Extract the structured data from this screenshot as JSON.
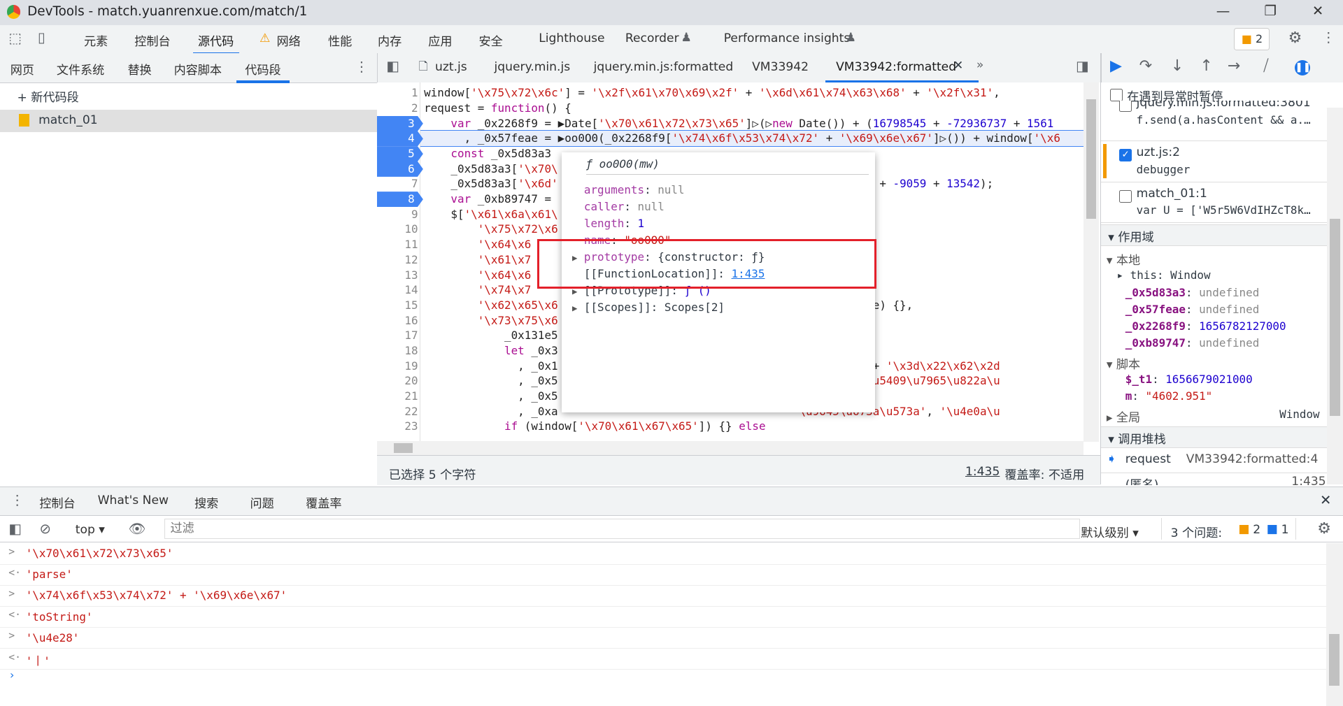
{
  "window": {
    "title": "DevTools - match.yuanrenxue.com/match/1"
  },
  "main_tabs": [
    "元素",
    "控制台",
    "源代码",
    "网络",
    "性能",
    "内存",
    "应用",
    "安全",
    "Lighthouse",
    "Recorder",
    "Performance insights"
  ],
  "issues_badge": "2",
  "navigator_tabs": [
    "网页",
    "文件系统",
    "替换",
    "内容脚本",
    "代码段"
  ],
  "new_snippet": "新代码段",
  "snippet_file": "match_01",
  "editor_tabs": [
    "uzt.js",
    "jquery.min.js",
    "jquery.min.js:formatted",
    "VM33942",
    "VM33942:formatted"
  ],
  "code_lines": [
    {
      "n": "1",
      "bp": false,
      "t": [
        [
          "",
          "window["
        ],
        [
          "s",
          "'\\x75\\x72\\x6c'"
        ],
        [
          "",
          "] = "
        ],
        [
          "s",
          "'\\x2f\\x61\\x70\\x69\\x2f'"
        ],
        [
          "",
          " + "
        ],
        [
          "s",
          "'\\x6d\\x61\\x74\\x63\\x68'"
        ],
        [
          "",
          " + "
        ],
        [
          "s",
          "'\\x2f\\x31'"
        ],
        [
          "",
          ","
        ]
      ]
    },
    {
      "n": "2",
      "bp": false,
      "t": [
        [
          "",
          "request = "
        ],
        [
          "k",
          "function"
        ],
        [
          "",
          "() {"
        ]
      ]
    },
    {
      "n": "3",
      "bp": true,
      "t": [
        [
          "",
          "    "
        ],
        [
          "k",
          "var"
        ],
        [
          "",
          " _0x2268f9 = ▶Date["
        ],
        [
          "s",
          "'\\x70\\x61\\x72\\x73\\x65'"
        ],
        [
          "",
          "]▷(▷"
        ],
        [
          "k",
          "new"
        ],
        [
          "",
          " Date()) + ("
        ],
        [
          "n",
          "16798545"
        ],
        [
          "",
          " + "
        ],
        [
          "n",
          "-72936737"
        ],
        [
          "",
          " + "
        ],
        [
          "n",
          "1561"
        ]
      ]
    },
    {
      "n": "4",
      "bp": true,
      "t": [
        [
          "",
          "      , _0x57feae = ▶oo0O0(_0x2268f9["
        ],
        [
          "s",
          "'\\x74\\x6f\\x53\\x74\\x72'"
        ],
        [
          "",
          " + "
        ],
        [
          "s",
          "'\\x69\\x6e\\x67'"
        ],
        [
          "",
          "]▷()) + window["
        ],
        [
          "s",
          "'\\x6"
        ]
      ]
    },
    {
      "n": "5",
      "bp": true,
      "t": [
        [
          "",
          "    "
        ],
        [
          "k",
          "const"
        ],
        [
          "",
          " _0x5d83a3"
        ]
      ]
    },
    {
      "n": "6",
      "bp": true,
      "t": [
        [
          "",
          "    _0x5d83a3["
        ],
        [
          "s",
          "'\\x70\\"
        ]
      ]
    },
    {
      "n": "7",
      "bp": false,
      "t": [
        [
          "",
          "    _0x5d83a3["
        ],
        [
          "s",
          "'\\x6d'"
        ],
        [
          "",
          "                                           "
        ],
        [
          "n",
          "3483"
        ],
        [
          "",
          " + "
        ],
        [
          "n",
          "-9059"
        ],
        [
          "",
          " + "
        ],
        [
          "n",
          "13542"
        ],
        [
          "",
          ");"
        ]
      ]
    },
    {
      "n": "8",
      "bp": true,
      "t": [
        [
          "",
          "    "
        ],
        [
          "k",
          "var"
        ],
        [
          "",
          " _0xb89747 ="
        ]
      ]
    },
    {
      "n": "9",
      "bp": false,
      "t": [
        [
          "",
          "    $["
        ],
        [
          "s",
          "'\\x61\\x6a\\x61\\"
        ]
      ]
    },
    {
      "n": "10",
      "bp": false,
      "t": [
        [
          "",
          "        "
        ],
        [
          "s",
          "'\\x75\\x72\\x6"
        ]
      ]
    },
    {
      "n": "11",
      "bp": false,
      "t": [
        [
          "",
          "        "
        ],
        [
          "s",
          "'\\x64\\x6"
        ]
      ]
    },
    {
      "n": "12",
      "bp": false,
      "t": [
        [
          "",
          "        "
        ],
        [
          "s",
          "'\\x61\\x7"
        ]
      ]
    },
    {
      "n": "13",
      "bp": false,
      "t": [
        [
          "",
          "        "
        ],
        [
          "s",
          "'\\x64\\x6"
        ]
      ]
    },
    {
      "n": "14",
      "bp": false,
      "t": [
        [
          "",
          "        "
        ],
        [
          "s",
          "'\\x74\\x7"
        ]
      ]
    },
    {
      "n": "15",
      "bp": false,
      "t": [
        [
          "",
          "        "
        ],
        [
          "s",
          "'\\x62\\x65\\x6"
        ],
        [
          "",
          "                                           c488e) {},"
        ]
      ]
    },
    {
      "n": "16",
      "bp": false,
      "t": [
        [
          "",
          "        "
        ],
        [
          "s",
          "'\\x73\\x75\\x6"
        ]
      ]
    },
    {
      "n": "17",
      "bp": false,
      "t": [
        [
          "",
          "            _0x131e5"
        ]
      ]
    },
    {
      "n": "18",
      "bp": false,
      "t": [
        [
          "",
          "            "
        ],
        [
          "k",
          "let"
        ],
        [
          "",
          " _0x3"
        ]
      ]
    },
    {
      "n": "19",
      "bp": false,
      "t": [
        [
          "",
          "              , _0x1                                    "
        ],
        [
          "s",
          "1\\x73\\x73'"
        ],
        [
          "",
          " + "
        ],
        [
          "s",
          "'\\x3d\\x22\\x62\\x2d"
        ]
      ]
    },
    {
      "n": "20",
      "bp": false,
      "t": [
        [
          "",
          "              , _0x5                                    "
        ],
        [
          "s",
          "\\u7a7a'"
        ],
        [
          "",
          ", "
        ],
        [
          "s",
          "'\\u5409\\u7965\\u822a\\u"
        ]
      ]
    },
    {
      "n": "21",
      "bp": false,
      "t": [
        [
          "",
          "              , _0x5"
        ]
      ]
    },
    {
      "n": "22",
      "bp": false,
      "t": [
        [
          "",
          "              , _0xa                                    "
        ],
        [
          "s",
          "\\u9645\\u673a\\u573a'"
        ],
        [
          "",
          ", "
        ],
        [
          "s",
          "'\\u4e0a\\u"
        ]
      ]
    },
    {
      "n": "23",
      "bp": false,
      "t": [
        [
          "",
          "            "
        ],
        [
          "k",
          "if"
        ],
        [
          "",
          " (window["
        ],
        [
          "s",
          "'\\x70\\x61\\x67\\x65'"
        ],
        [
          "",
          "]) {} "
        ],
        [
          "k",
          "else"
        ]
      ]
    }
  ],
  "popup": {
    "title": "ƒ oo0O0(mw)",
    "rows": [
      {
        "key": "arguments",
        "val": "null",
        "vc": "uv",
        "arrow": false
      },
      {
        "key": "caller",
        "val": "null",
        "vc": "uv",
        "arrow": false
      },
      {
        "key": "length",
        "val": "1",
        "vc": "nv",
        "arrow": false
      },
      {
        "key": "name",
        "val": "\"oo0O0\"",
        "vc": "stv",
        "arrow": false
      },
      {
        "key": "prototype",
        "val": "{constructor: ƒ}",
        "vc": "",
        "arrow": true
      },
      {
        "key": "[[FunctionLocation]]",
        "val": "1:435",
        "vc": "link",
        "arrow": false
      },
      {
        "key": "[[Prototype]]",
        "val": "ƒ ()",
        "vc": "nv",
        "arrow": true
      },
      {
        "key": "[[Scopes]]",
        "val": "Scopes[2]",
        "vc": "",
        "arrow": true
      }
    ]
  },
  "status": {
    "selection": "已选择 5 个字符",
    "position": "1:435",
    "coverage": "覆盖率: 不适用"
  },
  "right": {
    "pause_exceptions": "在遇到异常时暂停",
    "breakpoints": [
      {
        "file": "jquery.min.js:formatted:3801",
        "code": "f.send(a.hasContent && a.…",
        "checked": false
      },
      {
        "file": "uzt.js:2",
        "code": "debugger",
        "checked": true
      },
      {
        "file": "match_01:1",
        "code": "var U = ['W5r5W6VdIHZcT8k…",
        "checked": false
      }
    ],
    "scope_title": "作用域",
    "local_title": "本地",
    "this_row": "this: Window",
    "locals": [
      {
        "k": "_0x5d83a3",
        "v": "undefined",
        "c": "uv"
      },
      {
        "k": "_0x57feae",
        "v": "undefined",
        "c": "uv"
      },
      {
        "k": "_0x2268f9",
        "v": "1656782127000",
        "c": "nv"
      },
      {
        "k": "_0xb89747",
        "v": "undefined",
        "c": "uv"
      }
    ],
    "script_title": "脚本",
    "scripts": [
      {
        "k": "$_t1",
        "v": "1656679021000",
        "c": "nv"
      },
      {
        "k": "m",
        "v": "\"4602.951\"",
        "c": "stv"
      }
    ],
    "global_title": "全局",
    "global_val": "Window",
    "callstack_title": "调用堆栈",
    "frames": [
      {
        "name": "request",
        "loc": "VM33942:formatted:4"
      },
      {
        "name": "(匿名)",
        "loc": "1:435"
      }
    ]
  },
  "drawer": {
    "tabs": [
      "控制台",
      "What's New",
      "搜索",
      "问题",
      "覆盖率"
    ],
    "context": "top",
    "filter_placeholder": "过滤",
    "level": "默认级别",
    "issues": "3 个问题:",
    "issues_warn": "2",
    "issues_info": "1",
    "lines": [
      {
        "p": ">",
        "t": "'\\x70\\x61\\x72\\x73\\x65'"
      },
      {
        "p": "<·",
        "t": "'parse'"
      },
      {
        "p": ">",
        "t": "'\\x74\\x6f\\x53\\x74\\x72' + '\\x69\\x6e\\x67'"
      },
      {
        "p": "<·",
        "t": "'toString'"
      },
      {
        "p": ">",
        "t": "'\\u4e28'"
      },
      {
        "p": "<·",
        "t": "'丨'"
      }
    ]
  },
  "colors": {
    "accent": "#1a73e8",
    "breakpoint": "#4285f4",
    "highlight_box": "#e3202a",
    "warning": "#f29900"
  }
}
